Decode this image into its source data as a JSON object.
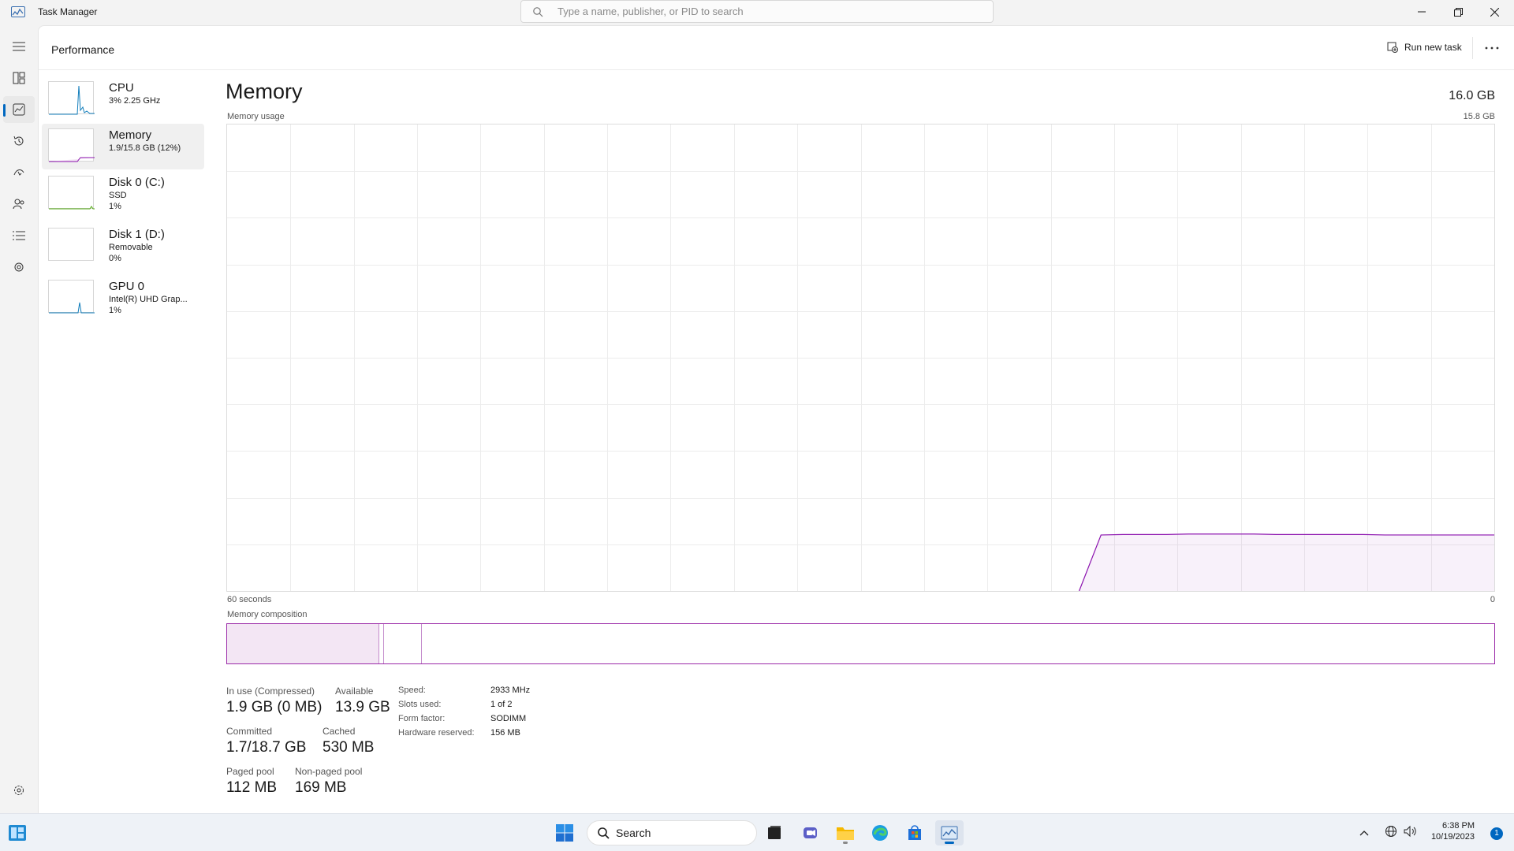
{
  "app": {
    "title": "Task Manager",
    "search_placeholder": "Type a name, publisher, or PID to search"
  },
  "header": {
    "page_title": "Performance",
    "run_new_task": "Run new task"
  },
  "devices": [
    {
      "name": "CPU",
      "line1": "3%  2.25 GHz",
      "line2": "",
      "color": "#117dbb"
    },
    {
      "name": "Memory",
      "line1": "1.9/15.8 GB (12%)",
      "line2": "",
      "color": "#8b12ae"
    },
    {
      "name": "Disk 0 (C:)",
      "line1": "SSD",
      "line2": "1%",
      "color": "#4da60c"
    },
    {
      "name": "Disk 1 (D:)",
      "line1": "Removable",
      "line2": "0%",
      "color": "#4da60c"
    },
    {
      "name": "GPU 0",
      "line1": "Intel(R) UHD Grap...",
      "line2": "1%",
      "color": "#117dbb"
    }
  ],
  "memory": {
    "title": "Memory",
    "total": "16.0 GB",
    "usage_label": "Memory usage",
    "max_label": "15.8 GB",
    "x_left": "60 seconds",
    "x_right": "0",
    "composition_label": "Memory composition",
    "composition": {
      "in_use_fraction": 0.12,
      "modified_fraction": 0.004,
      "standby_fraction": 0.03
    },
    "usage_history_fraction": [
      0,
      0,
      0,
      0,
      0,
      0,
      0,
      0,
      0,
      0,
      0,
      0,
      0,
      0,
      0,
      0,
      0,
      0,
      0,
      0,
      0,
      0,
      0,
      0,
      0,
      0,
      0,
      0,
      0,
      0,
      0,
      0,
      0,
      0,
      0,
      0,
      0,
      0,
      0,
      0,
      0.12,
      0.121,
      0.121,
      0.121,
      0.122,
      0.122,
      0.122,
      0.122,
      0.121,
      0.121,
      0.121,
      0.121,
      0.121,
      0.12,
      0.12,
      0.12,
      0.12,
      0.12,
      0.12
    ],
    "color": "#8b12ae",
    "stats": {
      "in_use_label": "In use (Compressed)",
      "in_use": "1.9 GB (0 MB)",
      "available_label": "Available",
      "available": "13.9 GB",
      "committed_label": "Committed",
      "committed": "1.7/18.7 GB",
      "cached_label": "Cached",
      "cached": "530 MB",
      "paged_label": "Paged pool",
      "paged": "112 MB",
      "nonpaged_label": "Non-paged pool",
      "nonpaged": "169 MB"
    },
    "specs": {
      "speed_label": "Speed:",
      "speed": "2933 MHz",
      "slots_label": "Slots used:",
      "slots": "1 of 2",
      "form_label": "Form factor:",
      "form": "SODIMM",
      "reserved_label": "Hardware reserved:",
      "reserved": "156 MB"
    }
  },
  "taskbar": {
    "search": "Search",
    "time": "6:38 PM",
    "date": "10/19/2023",
    "notification_count": "1"
  }
}
